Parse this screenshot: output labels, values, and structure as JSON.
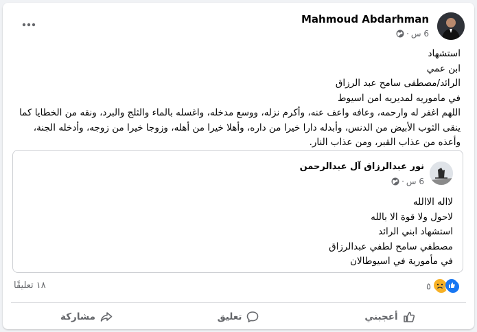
{
  "post": {
    "author": "Mahmoud Abdarhman",
    "time": "6 س",
    "separator": "·",
    "lines": [
      "استشهاد",
      "ابن عمي",
      "الرائد/مصطفى سامح عبد الرزاق",
      "في ماموريه لمديريه امن اسيوط",
      "اللهم اغفر له وارحمه، وعافه واعف عنه، وأكرم نزله، ووسع مدخله، واغسله بالماء والثلج والبرد، ونقه من الخطايا كما ينقى الثوب الأبيض من الدنس، وأبدله دارا خيرا من داره، وأهلا خيرا من أهله، وزوجا خيرا من زوجه، وأدخله الجنة، وأعذه من عذاب القبر، ومن عذاب النار."
    ]
  },
  "shared": {
    "author": "نور عبدالرزاق آل عبدالرحمن",
    "time": "6 س",
    "separator": "·",
    "lines": [
      "لااله الاالله",
      "لاحول ولا قوة الا بالله",
      "استشهاد  ابني الرائد",
      "مصطفي سامح لطفي عبدالرزاق",
      "في مأمورية في اسيوطالان"
    ]
  },
  "stats": {
    "reaction_count": "٥",
    "comment_count": "١٨ تعليقًا",
    "reactions": [
      "like-icon",
      "sad-icon"
    ]
  },
  "actions": {
    "like": "أعجبني",
    "comment": "تعليق",
    "share": "مشاركة"
  },
  "colors": {
    "background": "#f0f2f5",
    "card": "#ffffff",
    "secondary_text": "#65676b",
    "like_blue": "#1877f2",
    "sad_yellow": "#f7b125"
  }
}
